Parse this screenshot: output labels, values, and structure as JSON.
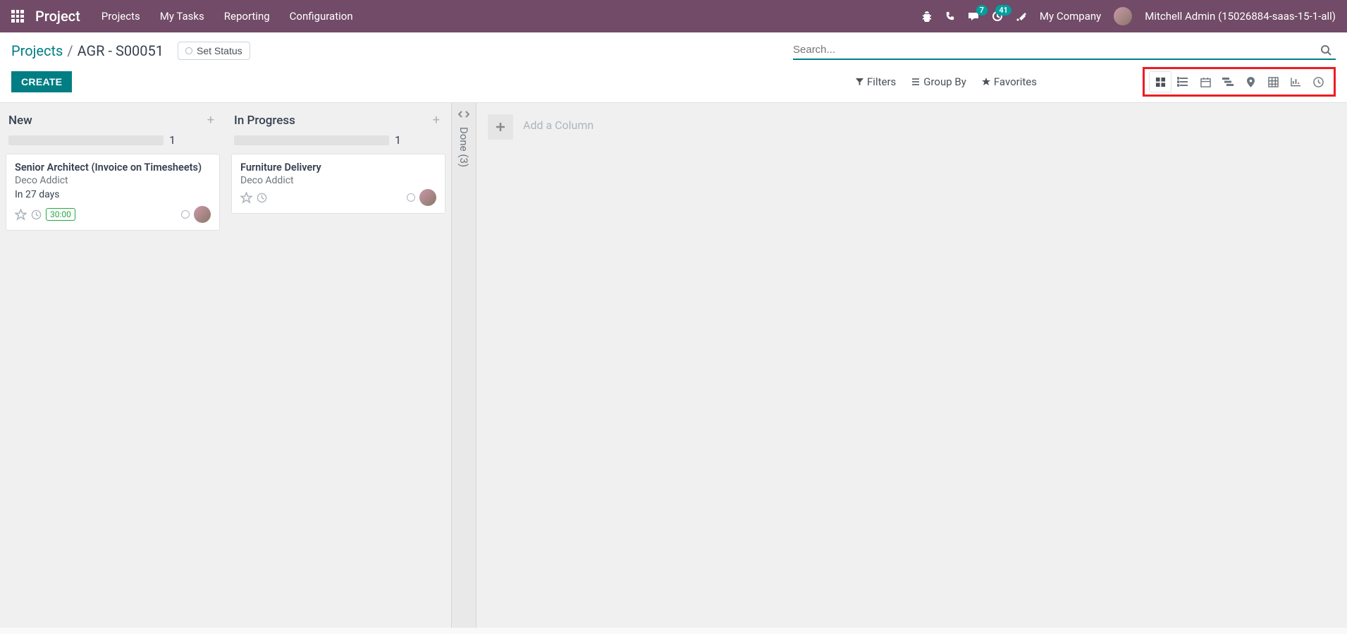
{
  "nav": {
    "brand": "Project",
    "items": [
      "Projects",
      "My Tasks",
      "Reporting",
      "Configuration"
    ],
    "messages_badge": "7",
    "activity_badge": "41",
    "company": "My Company",
    "user": "Mitchell Admin (15026884-saas-15-1-all)"
  },
  "breadcrumb": {
    "root": "Projects",
    "current": "AGR - S00051"
  },
  "buttons": {
    "set_status": "Set Status",
    "create": "CREATE"
  },
  "search": {
    "placeholder": "Search..."
  },
  "filters": {
    "filters": "Filters",
    "group_by": "Group By",
    "favorites": "Favorites"
  },
  "columns": {
    "new": {
      "title": "New",
      "count": "1"
    },
    "in_progress": {
      "title": "In Progress",
      "count": "1"
    },
    "done": {
      "title": "Done (3)"
    }
  },
  "cards": {
    "c1": {
      "title": "Senior Architect (Invoice on Timesheets)",
      "customer": "Deco Addict",
      "due": "In 27 days",
      "time": "30:00"
    },
    "c2": {
      "title": "Furniture Delivery",
      "customer": "Deco Addict"
    }
  },
  "add_column": "Add a Column"
}
